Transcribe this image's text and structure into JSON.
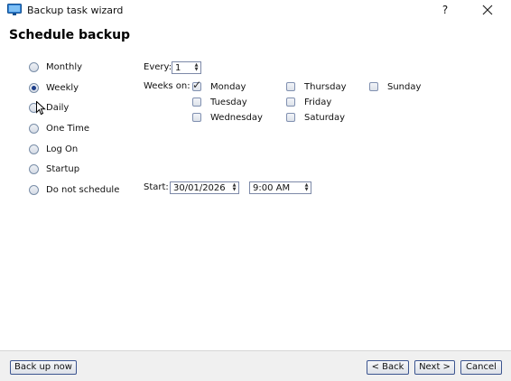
{
  "window": {
    "title": "Backup task wizard",
    "help": "?",
    "close": "✕"
  },
  "heading": "Schedule backup",
  "schedule_options": [
    {
      "label": "Monthly",
      "selected": false
    },
    {
      "label": "Weekly",
      "selected": true
    },
    {
      "label": "Daily",
      "selected": false
    },
    {
      "label": "One Time",
      "selected": false
    },
    {
      "label": "Log On",
      "selected": false
    },
    {
      "label": "Startup",
      "selected": false
    },
    {
      "label": "Do not schedule",
      "selected": false
    }
  ],
  "every": {
    "label": "Every:",
    "value": "1"
  },
  "weeks_on": {
    "label": "Weeks on:",
    "days": [
      {
        "label": "Monday",
        "checked": true
      },
      {
        "label": "Tuesday",
        "checked": false
      },
      {
        "label": "Wednesday",
        "checked": false
      },
      {
        "label": "Thursday",
        "checked": false
      },
      {
        "label": "Friday",
        "checked": false
      },
      {
        "label": "Saturday",
        "checked": false
      },
      {
        "label": "Sunday",
        "checked": false
      }
    ]
  },
  "start": {
    "label": "Start:",
    "date": "30/01/2026",
    "time": "9:00 AM"
  },
  "footer": {
    "backup_now": "Back up now",
    "back": "< Back",
    "next": "Next >",
    "cancel": "Cancel"
  }
}
